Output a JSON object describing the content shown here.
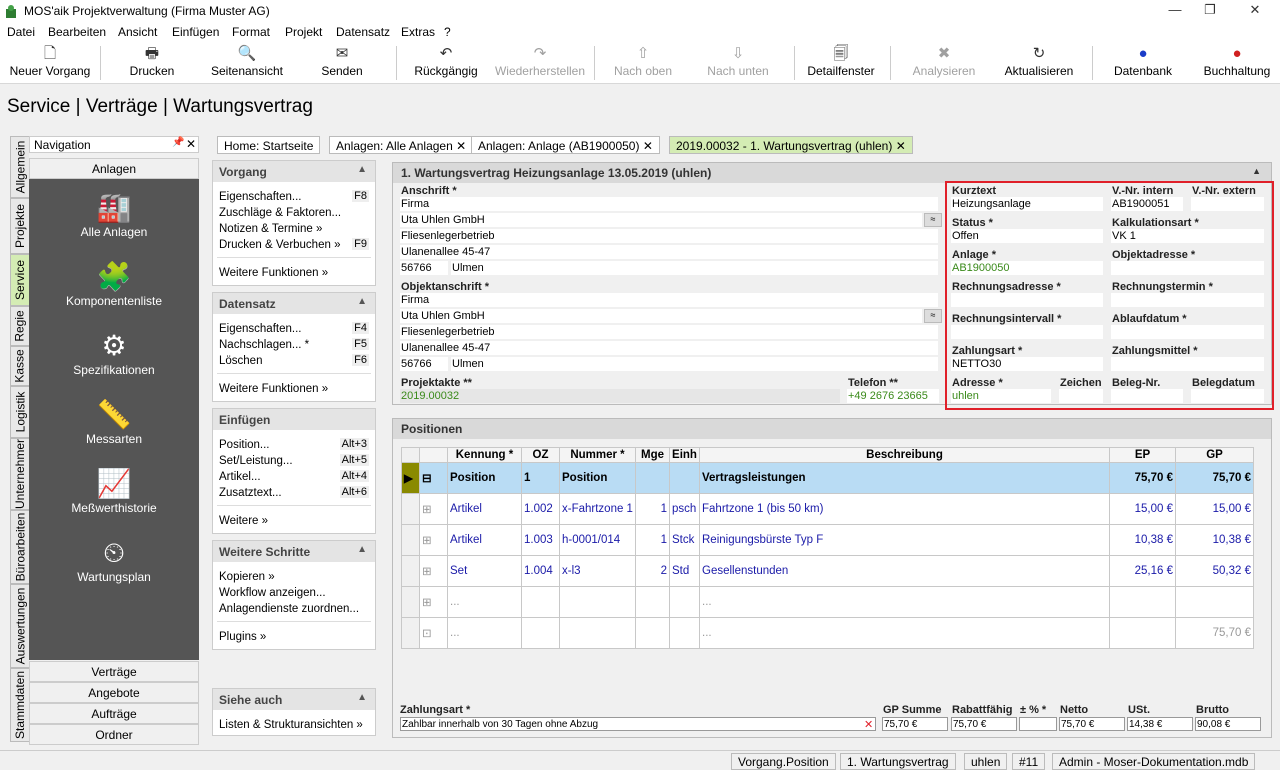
{
  "window": {
    "title": "MOS'aik Projektverwaltung (Firma Muster AG)",
    "minimize": "—",
    "restore": "❐",
    "close": "✕"
  },
  "menu": [
    "Datei",
    "Bearbeiten",
    "Ansicht",
    "Einfügen",
    "Format",
    "Projekt",
    "Datensatz",
    "Extras",
    "?"
  ],
  "toolbar": {
    "neuer_vorgang": "Neuer Vorgang",
    "drucken": "Drucken",
    "seitenansicht": "Seitenansicht",
    "senden": "Senden",
    "rueckgaengig": "Rückgängig",
    "wiederherstellen": "Wiederherstellen",
    "nach_oben": "Nach oben",
    "nach_unten": "Nach unten",
    "detailfenster": "Detailfenster",
    "analysieren": "Analysieren",
    "aktualisieren": "Aktualisieren",
    "datenbank": "Datenbank",
    "buchhaltung": "Buchhaltung"
  },
  "page_title": "Service | Verträge | Wartungsvertrag",
  "vtabs": [
    "Allgemein",
    "Projekte",
    "Service",
    "Regie",
    "Kasse",
    "Logistik",
    "Unternehmer",
    "Büroarbeiten",
    "Auswertungen",
    "Stammdaten"
  ],
  "nav": {
    "header": "Navigation",
    "pin": "📌",
    "close": "✕",
    "section": "Anlagen",
    "items": [
      "Alle Anlagen",
      "Komponentenliste",
      "Spezifikationen",
      "Messarten",
      "Meßwerthistorie",
      "Wartungsplan"
    ],
    "bottom": [
      "Verträge",
      "Angebote",
      "Aufträge",
      "Ordner"
    ]
  },
  "tabs": [
    "Home: Startseite",
    "Anlagen: Alle Anlagen",
    "Anlagen: Anlage (AB1900050)",
    "2019.00032 - 1. Wartungsvertrag (uhlen)"
  ],
  "tab_close": "✕",
  "vorgang": {
    "title": "Vorgang",
    "rows": [
      [
        "Eigenschaften...",
        "F8"
      ],
      [
        "Zuschläge & Faktoren...",
        ""
      ],
      [
        "Notizen & Termine »",
        ""
      ],
      [
        "Drucken & Verbuchen »",
        "F9"
      ]
    ],
    "more": "Weitere Funktionen »"
  },
  "datensatz": {
    "title": "Datensatz",
    "rows": [
      [
        "Eigenschaften...",
        "F4"
      ],
      [
        "Nachschlagen... *",
        "F5"
      ],
      [
        "Löschen",
        "F6"
      ]
    ],
    "more": "Weitere Funktionen »"
  },
  "einfuegen": {
    "title": "Einfügen",
    "rows": [
      [
        "Position...",
        "Alt+3"
      ],
      [
        "Set/Leistung...",
        "Alt+5"
      ],
      [
        "Artikel...",
        "Alt+4"
      ],
      [
        "Zusatztext...",
        "Alt+6"
      ]
    ],
    "more": "Weitere »"
  },
  "schritte": {
    "title": "Weitere Schritte",
    "rows": [
      "Kopieren »",
      "Workflow anzeigen...",
      "Anlagendienste zuordnen..."
    ],
    "more": "Plugins »"
  },
  "siehe": {
    "title": "Siehe auch",
    "rows": [
      "Listen & Strukturansichten »"
    ]
  },
  "form": {
    "title": "1. Wartungsvertrag Heizungsanlage 13.05.2019 (uhlen)",
    "anschrift_label": "Anschrift *",
    "anschrift": [
      "Firma",
      "Uta Uhlen GmbH",
      "Fliesenlegerbetrieb",
      "Ulanenallee 45-47"
    ],
    "plz": "56766",
    "ort": "Ulmen",
    "objekt_label": "Objektanschrift *",
    "objekt": [
      "Firma",
      "Uta Uhlen GmbH",
      "Fliesenlegerbetrieb",
      "Ulanenallee 45-47"
    ],
    "objekt_plz": "56766",
    "objekt_ort": "Ulmen",
    "projektakte_label": "Projektakte **",
    "projektakte": "2019.00032",
    "telefon_label": "Telefon **",
    "telefon": "+49 2676 23665",
    "kurztext_label": "Kurztext",
    "kurztext": "Heizungsanlage",
    "vnr_intern_label": "V.-Nr. intern",
    "vnr_intern": "AB1900051",
    "vnr_extern_label": "V.-Nr. extern",
    "status_label": "Status *",
    "status": "Offen",
    "kalk_label": "Kalkulationsart *",
    "kalk": "VK 1",
    "anlage_label": "Anlage *",
    "anlage": "AB1900050",
    "objektadresse_label": "Objektadresse *",
    "rechnungsadresse_label": "Rechnungsadresse *",
    "rechnungstermin_label": "Rechnungstermin *",
    "rechnungsintervall_label": "Rechnungsintervall *",
    "ablaufdatum_label": "Ablaufdatum *",
    "zahlungsart_label": "Zahlungsart *",
    "zahlungsart": "NETTO30",
    "zahlungsmittel_label": "Zahlungsmittel *",
    "adresse_label": "Adresse *",
    "adresse": "uhlen",
    "zeichen_label": "Zeichen",
    "belegnr_label": "Beleg-Nr.",
    "belegdatum_label": "Belegdatum"
  },
  "positionen": {
    "title": "Positionen",
    "columns": [
      "Kennung *",
      "OZ",
      "Nummer *",
      "Mge",
      "Einh",
      "Beschreibung",
      "EP",
      "GP"
    ],
    "rows": [
      {
        "kennung": "Position",
        "oz": "1",
        "nummer": "Position",
        "mge": "",
        "einh": "",
        "beschreibung": "Vertragsleistungen",
        "ep": "75,70 €",
        "gp": "75,70 €"
      },
      {
        "kennung": "Artikel",
        "oz": "1.002",
        "nummer": "x-Fahrtzone 1",
        "mge": "1",
        "einh": "psch",
        "beschreibung": "Fahrtzone 1 (bis 50 km)",
        "ep": "15,00 €",
        "gp": "15,00 €"
      },
      {
        "kennung": "Artikel",
        "oz": "1.003",
        "nummer": "h-0001/014",
        "mge": "1",
        "einh": "Stck",
        "beschreibung": "Reinigungsbürste Typ F",
        "ep": "10,38 €",
        "gp": "10,38 €"
      },
      {
        "kennung": "Set",
        "oz": "1.004",
        "nummer": "x-l3",
        "mge": "2",
        "einh": "Std",
        "beschreibung": "Gesellenstunden",
        "ep": "25,16 €",
        "gp": "50,32 €"
      }
    ],
    "empty1": "...",
    "empty2": "...",
    "total": "75,70 €"
  },
  "summary": {
    "zahlungsart_label": "Zahlungsart *",
    "zahlungsart": "Zahlbar innerhalb von 30 Tagen ohne Abzug",
    "gp_summe_label": "GP Summe",
    "gp_summe": "75,70 €",
    "rabatt_label": "Rabattfähig",
    "rabatt": "75,70 €",
    "pm_label": "± % *",
    "netto_label": "Netto",
    "netto": "75,70 €",
    "ust_label": "USt.",
    "ust": "14,38 €",
    "brutto_label": "Brutto",
    "brutto": "90,08 €"
  },
  "statusbar": [
    "Vorgang.Position",
    "1. Wartungsvertrag",
    "uhlen",
    "#11",
    "Admin - Moser-Dokumentation.mdb"
  ],
  "colors": {
    "accent_tab": "#d4ecb4",
    "highlight_box": "#e0202a",
    "selected_row": "#b9dcf4",
    "nav_dark": "#555555"
  }
}
